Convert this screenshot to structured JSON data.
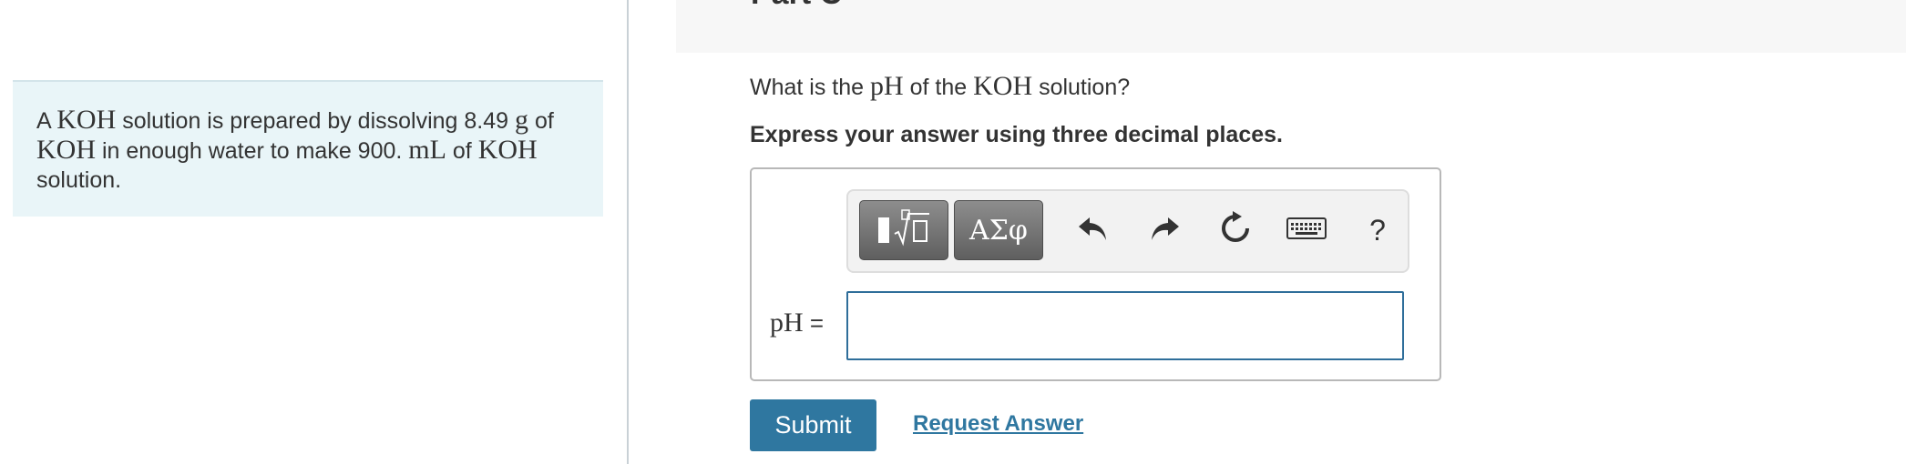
{
  "part": {
    "title": "Part C"
  },
  "problem": {
    "seg1": "A ",
    "chem1": "KOH",
    "seg2": " solution is prepared by dissolving 8.49 ",
    "unit1": "g",
    "seg3": " of ",
    "chem2": "KOH",
    "seg4": " in enough water to make 900. ",
    "unit2": "mL",
    "seg5": " of ",
    "chem3": "KOH",
    "seg6": " solution."
  },
  "question": {
    "seg1": "What is the ",
    "ph": "pH",
    "seg2": " of the ",
    "chem": "KOH",
    "seg3": " solution?"
  },
  "instruction": "Express your answer using three decimal places.",
  "answer": {
    "label": "pH",
    "equals": " =",
    "value": "",
    "toolbar": {
      "templates_icon": "templates-sqrt-icon",
      "greek_label": "ΑΣφ",
      "undo_icon": "undo-icon",
      "redo_icon": "redo-icon",
      "reset_icon": "reset-icon",
      "keyboard_icon": "keyboard-icon",
      "help_label": "?"
    }
  },
  "actions": {
    "submit_label": "Submit",
    "request_label": "Request Answer"
  },
  "colors": {
    "accent": "#2f77a0",
    "problem_bg": "#e9f5f8",
    "input_border": "#2f6e9a"
  }
}
